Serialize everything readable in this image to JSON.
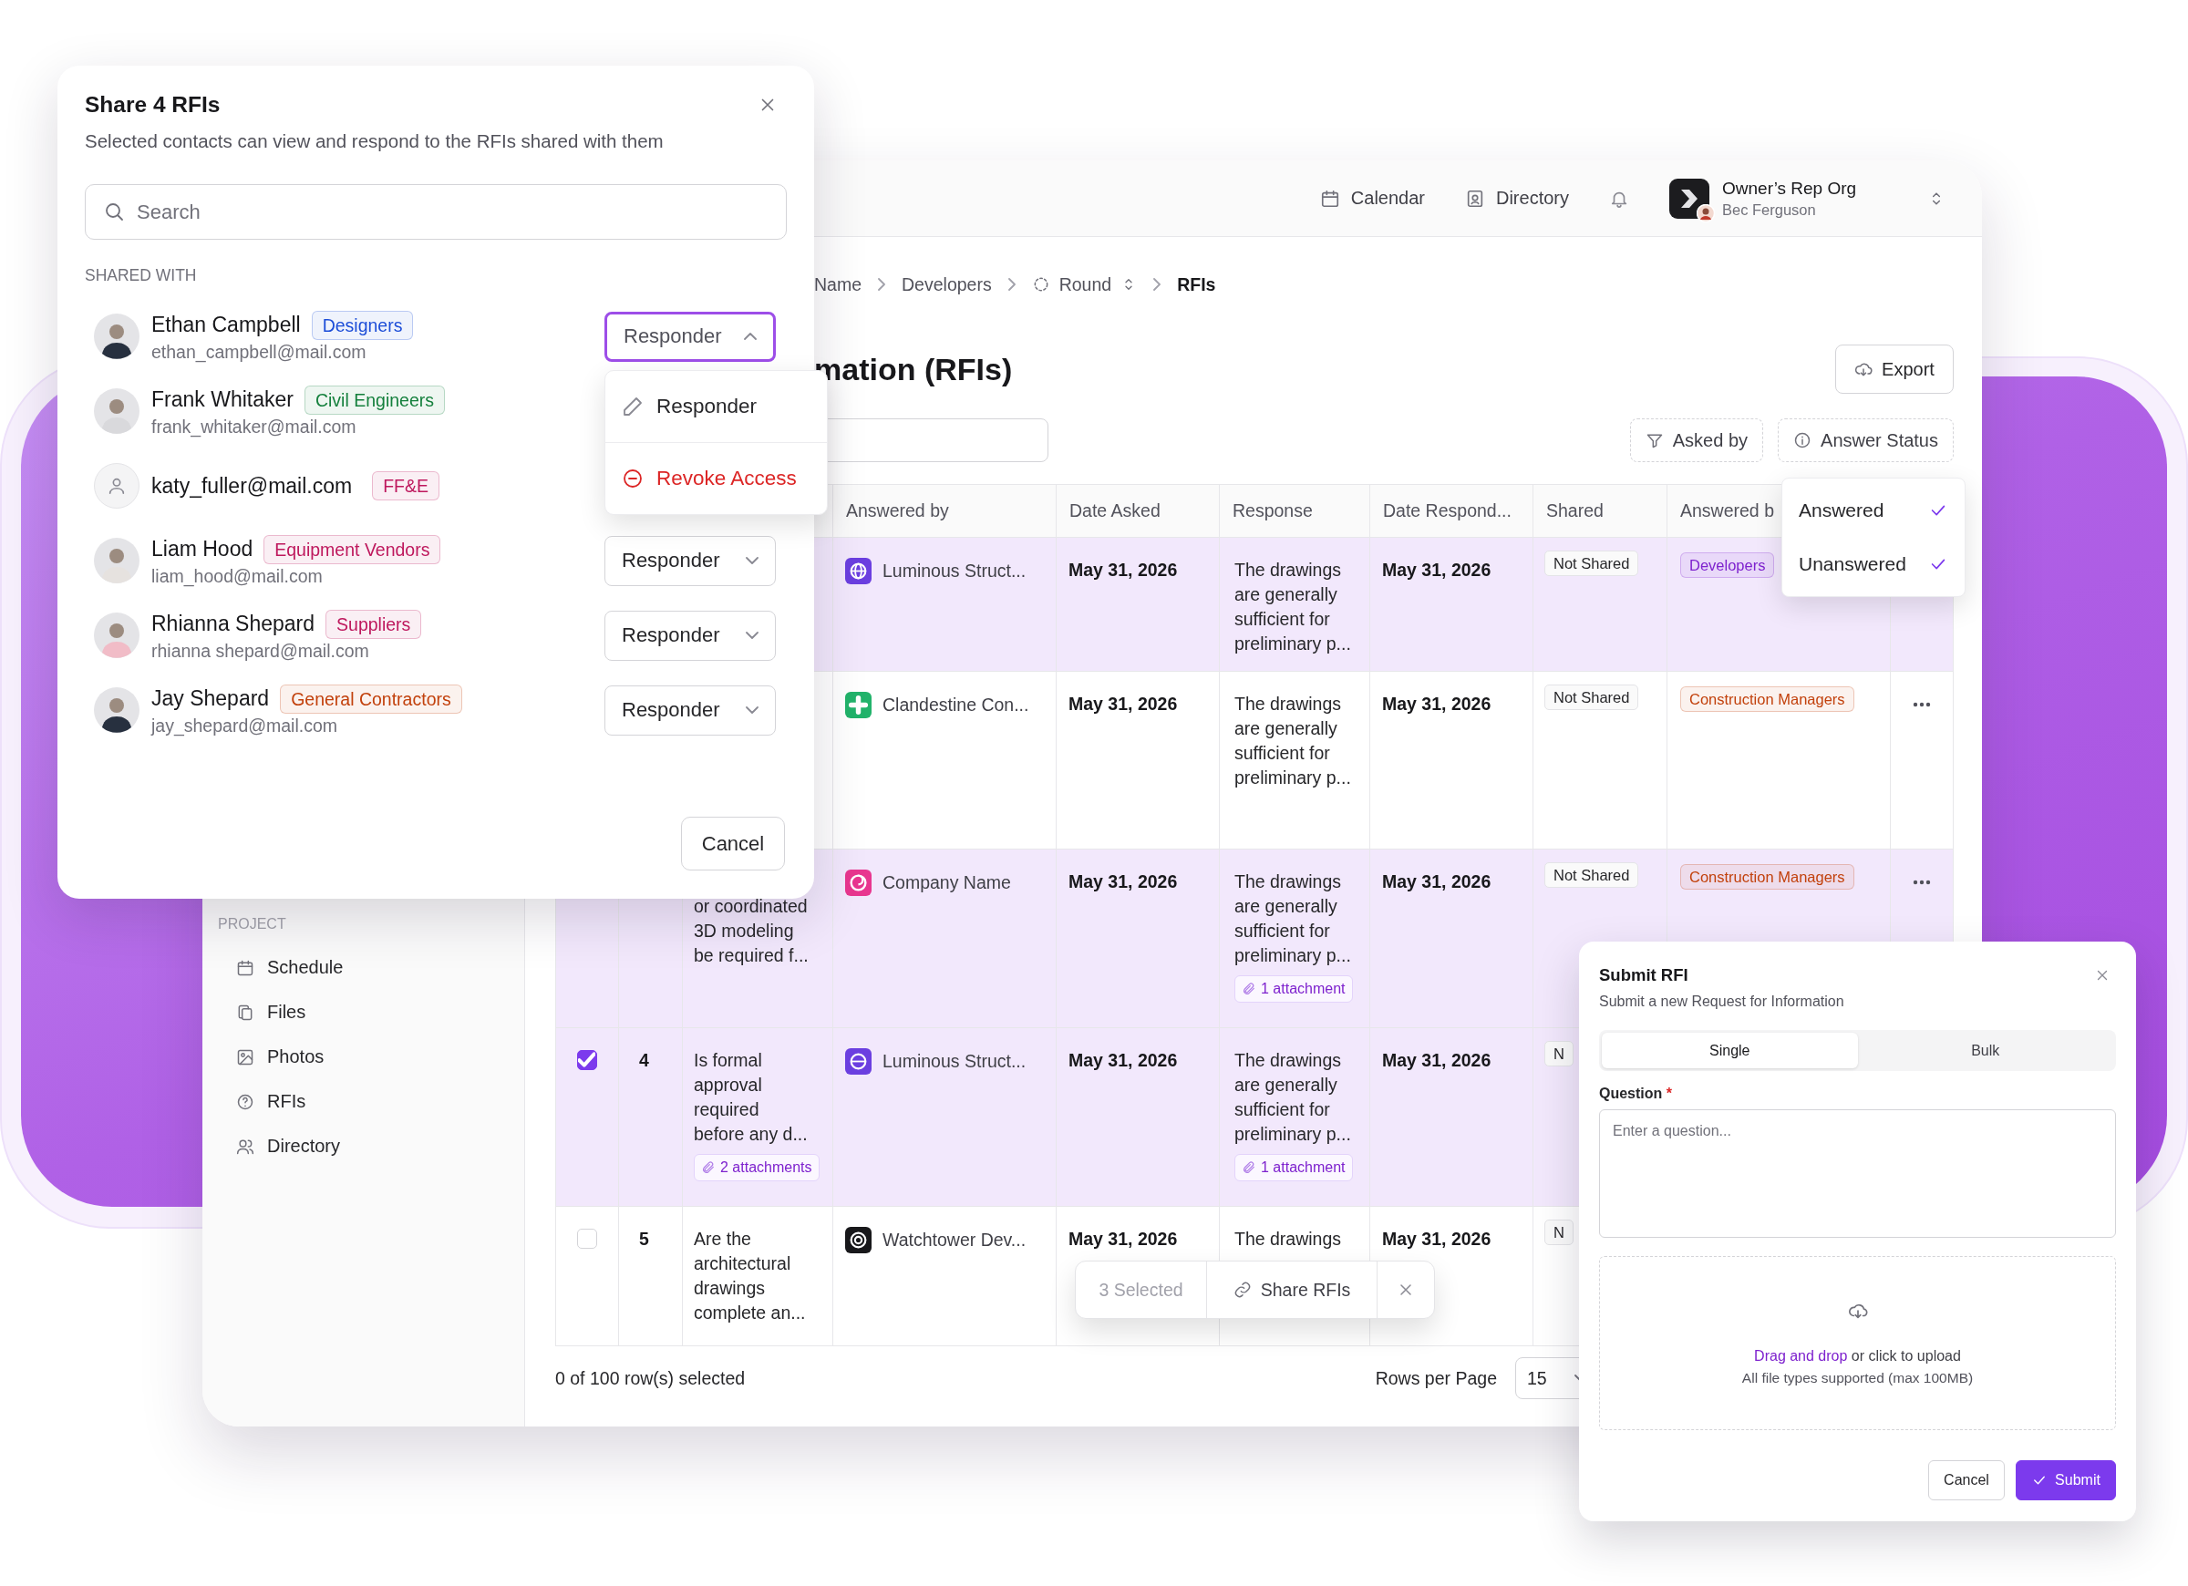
{
  "app": {
    "header": {
      "links": [
        {
          "label": "Calendar"
        },
        {
          "label": "Directory"
        }
      ],
      "org": {
        "name": "Owner’s Rep Org",
        "user": "Bec Ferguson"
      }
    },
    "breadcrumb": [
      {
        "label": "Name",
        "kind": "link"
      },
      {
        "label": "Developers",
        "kind": "link"
      },
      {
        "label": "Round",
        "kind": "switcher"
      },
      {
        "label": "RFIs",
        "kind": "current"
      }
    ],
    "page_title": "mation (RFIs)",
    "export_button": "Export",
    "filters": [
      {
        "label": "Asked by"
      },
      {
        "label": "Answer Status"
      }
    ],
    "sidebar": {
      "section": "PROJECT",
      "items": [
        {
          "label": "Schedule"
        },
        {
          "label": "Files"
        },
        {
          "label": "Photos"
        },
        {
          "label": "RFIs"
        },
        {
          "label": "Directory"
        }
      ]
    },
    "table": {
      "columns": [
        "Answered by",
        "Date Asked",
        "Response",
        "Date Respond...",
        "Shared",
        "Answered b"
      ],
      "rows": [
        {
          "selected": true,
          "company": {
            "name": "Luminous Struct...",
            "color": "#6b3fe0"
          },
          "date_asked": "May 31, 2026",
          "response": "The drawings are generally sufficient for preliminary p...",
          "date_responded": "May 31, 2026",
          "shared": "Not Shared",
          "answered_by": {
            "label": "Developers",
            "color": "#7e22ce"
          }
        },
        {
          "selected": false,
          "company": {
            "name": "Clandestine Con...",
            "color": "#22b36b"
          },
          "date_asked": "May 31, 2026",
          "response": "The drawings are generally sufficient for preliminary p...",
          "date_responded": "May 31, 2026",
          "shared": "Not Shared",
          "answered_by": {
            "label": "Construction Managers",
            "color": "#c2410c"
          },
          "actions": true
        },
        {
          "selected": true,
          "question": "or coordinated 3D modeling be required f...",
          "company": {
            "name": "Company Name",
            "color": "#e8368f"
          },
          "date_asked": "May 31, 2026",
          "response": "The drawings are generally sufficient for preliminary p...",
          "response_attachment": "1 attachment",
          "date_responded": "May 31, 2026",
          "shared": "Not Shared",
          "answered_by": {
            "label": "Construction Managers",
            "color": "#c2410c"
          },
          "actions": true
        },
        {
          "selected": true,
          "number": "4",
          "question": "Is formal approval required before any d...",
          "question_attachment": "2 attachments",
          "company": {
            "name": "Luminous Struct...",
            "color": "#6b3fe0"
          },
          "date_asked": "May 31, 2026",
          "response": "The drawings are generally sufficient for preliminary p...",
          "response_attachment": "1 attachment",
          "date_responded": "May 31, 2026",
          "shared": "N"
        },
        {
          "selected": false,
          "number": "5",
          "question": "Are the architectural drawings complete an...",
          "company": {
            "name": "Watchtower Dev...",
            "color": "#18181b"
          },
          "date_asked": "May 31, 2026",
          "response": "The drawings",
          "date_responded": "May 31, 2026",
          "shared": "N"
        }
      ]
    },
    "footer": {
      "selection": "0 of 100 row(s) selected",
      "rows_per_page_label": "Rows per Page",
      "rows_per_page": "15"
    }
  },
  "share_dialog": {
    "title": "Share 4 RFIs",
    "subtitle": "Selected contacts can view and respond to the RFIs shared with them",
    "search": {
      "placeholder": "Search"
    },
    "section": "SHARED WITH",
    "contacts": [
      {
        "name": "Ethan Campbell",
        "email": "ethan_campbell@mail.com",
        "tag": {
          "label": "Designers",
          "color": "#1d4ed8"
        },
        "role": {
          "label": "Responder",
          "open": true
        }
      },
      {
        "name": "Frank Whitaker",
        "email": "frank_whitaker@mail.com",
        "tag": {
          "label": "Civil Engineers",
          "color": "#15803d"
        }
      },
      {
        "email": "katy_fuller@mail.com",
        "tag": {
          "label": "FF&E",
          "color": "#be185d"
        }
      },
      {
        "name": "Liam Hood",
        "email": "liam_hood@mail.com",
        "tag": {
          "label": "Equipment Vendors",
          "color": "#be185d"
        },
        "role": {
          "label": "Responder",
          "open": false
        }
      },
      {
        "name": "Rhianna Shepard",
        "email": "rhianna shepard@mail.com",
        "tag": {
          "label": "Suppliers",
          "color": "#be185d"
        },
        "role": {
          "label": "Responder",
          "open": false
        }
      },
      {
        "name": "Jay Shepard",
        "email": "jay_shepard@mail.com",
        "tag": {
          "label": "General Contractors",
          "color": "#c2410c"
        },
        "role": {
          "label": "Responder",
          "open": false
        }
      }
    ],
    "cancel_button": "Cancel"
  },
  "role_menu": {
    "items": [
      {
        "label": "Responder",
        "kind": "edit"
      },
      {
        "label": "Revoke Access",
        "kind": "danger"
      }
    ]
  },
  "answer_status_menu": {
    "items": [
      {
        "label": "Answered",
        "checked": true
      },
      {
        "label": "Unanswered",
        "checked": true
      }
    ]
  },
  "selection_bar": {
    "count": "3 Selected",
    "action": "Share RFIs"
  },
  "submit_panel": {
    "title": "Submit RFI",
    "subtitle": "Submit a new Request for Information",
    "modes": [
      {
        "label": "Single",
        "selected": true
      },
      {
        "label": "Bulk",
        "selected": false
      }
    ],
    "question_label": "Question",
    "required_mark": "*",
    "question": {
      "placeholder": "Enter a question..."
    },
    "upload": {
      "link": "Drag and drop",
      "text": "or click to upload",
      "hint": "All file types supported (max 100MB)"
    },
    "cancel_button": "Cancel",
    "submit_button": "Submit"
  }
}
